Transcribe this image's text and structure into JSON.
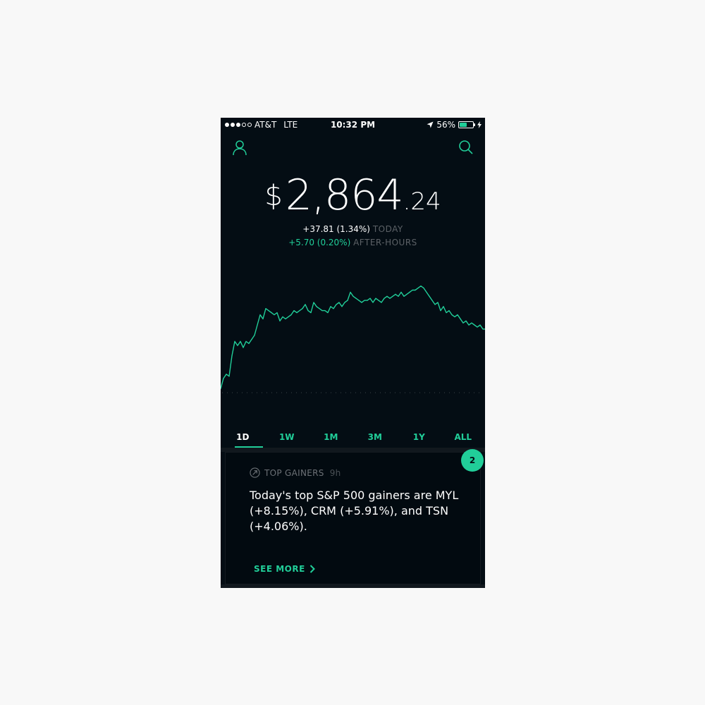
{
  "status_bar": {
    "carrier": "AT&T",
    "network": "LTE",
    "time": "10:32 PM",
    "battery_percent": "56%",
    "battery_level": 0.56,
    "signal_bars_filled": 3,
    "signal_bars_total": 5
  },
  "header": {
    "left_icon": "profile-icon",
    "right_icon": "search-icon"
  },
  "portfolio": {
    "currency_symbol": "$",
    "value_main": "2,864",
    "value_cents": ".24",
    "today_change": "+37.81 (1.34%)",
    "today_label": "TODAY",
    "after_hours_change": "+5.70 (0.20%)",
    "after_hours_label": "AFTER-HOURS"
  },
  "chart_data": {
    "type": "line",
    "title": "",
    "xlabel": "",
    "ylabel": "",
    "x": [
      0,
      4,
      8,
      12,
      16,
      20,
      24,
      28,
      32,
      36,
      40,
      44,
      48,
      52,
      56,
      60,
      64,
      68,
      72,
      76,
      80,
      84,
      88,
      92,
      96,
      100,
      104,
      108,
      112,
      116,
      120,
      124,
      128,
      132,
      136,
      140,
      144,
      148,
      152,
      156,
      160,
      164,
      168,
      172,
      176,
      180,
      184,
      188,
      192,
      196,
      200,
      204,
      208,
      212,
      216,
      220,
      224,
      228,
      232,
      236,
      240,
      244,
      248,
      252,
      256,
      260,
      264,
      268,
      272,
      276,
      280,
      284,
      288,
      292,
      296,
      300,
      304,
      308,
      312,
      316,
      320,
      324,
      328,
      332,
      336,
      340,
      344,
      348,
      352,
      356,
      360,
      364,
      368,
      372,
      375
    ],
    "values": [
      2,
      7,
      9,
      8,
      18,
      25,
      23,
      25,
      22,
      25,
      24,
      26,
      28,
      33,
      38,
      36,
      41,
      40,
      39,
      38,
      39,
      35,
      37,
      36,
      37,
      38,
      40,
      39,
      40,
      41,
      43,
      40,
      39,
      44,
      42,
      41,
      40,
      40,
      39,
      42,
      41,
      43,
      44,
      42,
      44,
      45,
      49,
      47,
      46,
      45,
      44,
      45,
      45,
      46,
      44,
      46,
      45,
      44,
      46,
      47,
      46,
      47,
      48,
      47,
      49,
      47,
      48,
      49,
      50,
      50,
      51,
      52,
      51,
      49,
      47,
      45,
      43,
      44,
      40,
      42,
      39,
      40,
      38,
      37,
      38,
      36,
      34,
      35,
      33,
      34,
      33,
      32,
      33,
      31,
      31
    ],
    "ylim": [
      0,
      55
    ],
    "baseline": 0,
    "baseline_style": "dotted",
    "line_color": "#21ce99",
    "grid": false,
    "legend": "none"
  },
  "range_tabs": [
    {
      "label": "1D",
      "active": true
    },
    {
      "label": "1W",
      "active": false
    },
    {
      "label": "1M",
      "active": false
    },
    {
      "label": "3M",
      "active": false
    },
    {
      "label": "1Y",
      "active": false
    },
    {
      "label": "ALL",
      "active": false
    }
  ],
  "card": {
    "icon": "trending-up-circle-icon",
    "category": "TOP GAINERS",
    "time_ago": "9h",
    "body_line1": "Today's top S&P 500 gainers are MYL",
    "body_line2": "(+8.15%), CRM (+5.91%), and TSN",
    "body_line3": "(+4.06%).",
    "see_more": "SEE MORE",
    "badge_count": "2"
  },
  "colors": {
    "background": "#040d14",
    "accent": "#21ce99",
    "muted_text": "#5c6166"
  }
}
